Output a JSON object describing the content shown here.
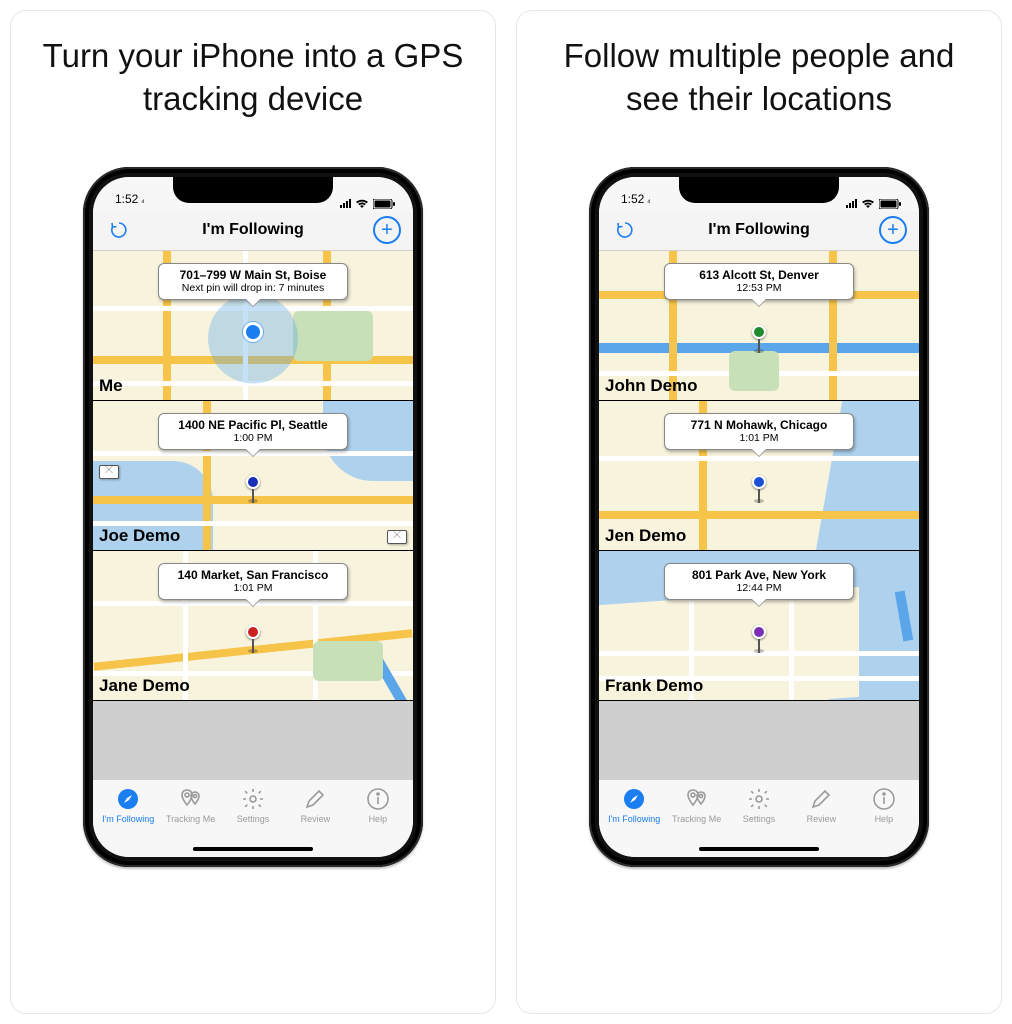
{
  "colors": {
    "accent": "#1a7df0"
  },
  "panels": [
    {
      "headline": "Turn your iPhone into a GPS tracking device",
      "status_time": "1:52",
      "nav": {
        "title": "I'm Following",
        "refresh_icon": "refresh-icon",
        "add_icon": "plus-circle-icon"
      },
      "cells": [
        {
          "name": "Me",
          "callout_title": "701–799 W Main St, Boise",
          "callout_sub": "Next pin will drop in: 7 minutes",
          "pin_color": "blue-dot",
          "show_halo": true
        },
        {
          "name": "Joe Demo",
          "callout_title": "1400 NE Pacific Pl, Seattle",
          "callout_sub": "1:00 PM",
          "pin_color": "#1a2fb5",
          "show_mail": true
        },
        {
          "name": "Jane Demo",
          "callout_title": "140 Market, San Francisco",
          "callout_sub": "1:01 PM",
          "pin_color": "#cc1f1f"
        }
      ],
      "tabs": [
        {
          "label": "I'm Following",
          "icon": "compass-icon",
          "active": true
        },
        {
          "label": "Tracking Me",
          "icon": "double-pin-icon",
          "active": false
        },
        {
          "label": "Settings",
          "icon": "gear-icon",
          "active": false
        },
        {
          "label": "Review",
          "icon": "pencil-icon",
          "active": false
        },
        {
          "label": "Help",
          "icon": "info-icon",
          "active": false
        }
      ]
    },
    {
      "headline": "Follow multiple people and see their locations",
      "status_time": "1:52",
      "nav": {
        "title": "I'm Following",
        "refresh_icon": "refresh-icon",
        "add_icon": "plus-circle-icon"
      },
      "cells": [
        {
          "name": "John Demo",
          "callout_title": "613 Alcott St, Denver",
          "callout_sub": "12:53 PM",
          "pin_color": "#1f8a2e"
        },
        {
          "name": "Jen Demo",
          "callout_title": "771 N Mohawk, Chicago",
          "callout_sub": "1:01 PM",
          "pin_color": "#1a4fd6"
        },
        {
          "name": "Frank Demo",
          "callout_title": "801 Park Ave, New York",
          "callout_sub": "12:44 PM",
          "pin_color": "#7a2fb5"
        }
      ],
      "tabs": [
        {
          "label": "I'm Following",
          "icon": "compass-icon",
          "active": true
        },
        {
          "label": "Tracking Me",
          "icon": "double-pin-icon",
          "active": false
        },
        {
          "label": "Settings",
          "icon": "gear-icon",
          "active": false
        },
        {
          "label": "Review",
          "icon": "pencil-icon",
          "active": false
        },
        {
          "label": "Help",
          "icon": "info-icon",
          "active": false
        }
      ]
    }
  ]
}
